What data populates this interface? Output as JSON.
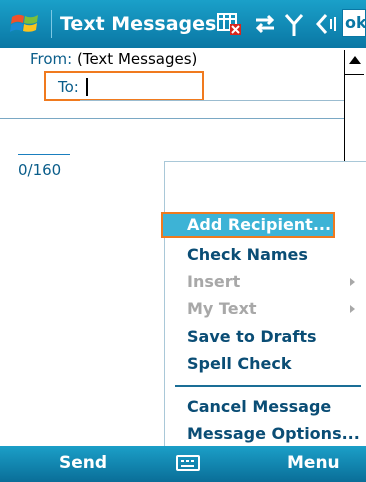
{
  "titlebar": {
    "title": "Text Messages",
    "ok_label": "ok",
    "indicators": [
      "no-signal-icon",
      "data-connection-icon",
      "signal-icon",
      "speaker-icon"
    ]
  },
  "compose": {
    "from_label": "From:",
    "from_value": "(Text Messages)",
    "to_label": "To:",
    "to_value": "",
    "char_count": "0/160"
  },
  "menu": {
    "items": [
      {
        "label": "Add Recipient...",
        "state": "selected"
      },
      {
        "label": "Check Names",
        "state": "enabled"
      },
      {
        "label": "Insert",
        "state": "disabled",
        "submenu": true
      },
      {
        "label": "My Text",
        "state": "disabled",
        "submenu": true
      },
      {
        "label": "Save to Drafts",
        "state": "enabled"
      },
      {
        "label": "Spell Check",
        "state": "enabled"
      },
      {
        "label": "Cancel Message",
        "state": "enabled"
      },
      {
        "label": "Message Options...",
        "state": "enabled"
      }
    ]
  },
  "softkeys": {
    "left": "Send",
    "right": "Menu",
    "center_icon": "keyboard-icon"
  },
  "colors": {
    "titlebar": "#0a77a4",
    "highlight": "#3db3d6",
    "focus_border": "#f07a1e",
    "menu_text": "#0a4d75"
  }
}
